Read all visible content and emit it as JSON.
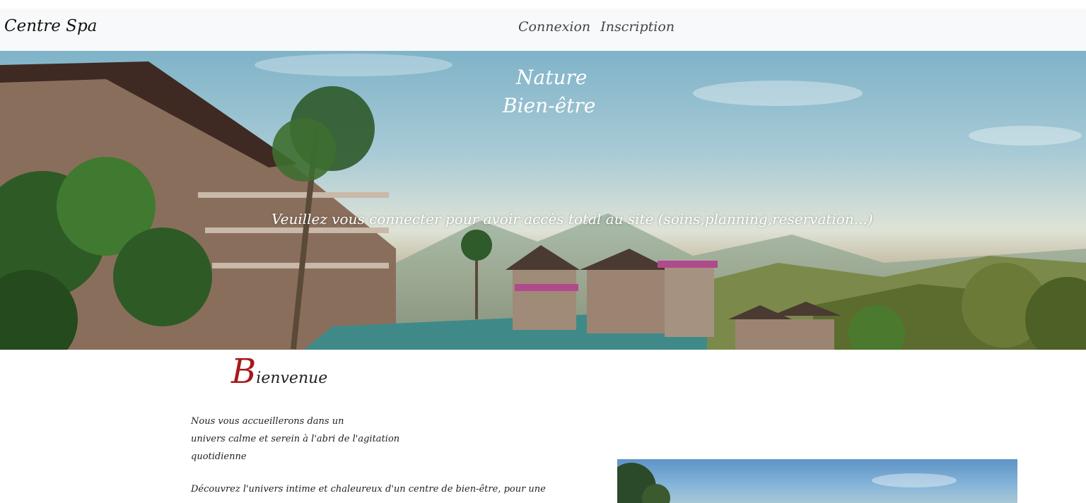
{
  "navbar": {
    "brand": "Centre Spa",
    "links": [
      "Connexion",
      "Inscription"
    ]
  },
  "hero": {
    "title_line1": "Nature",
    "title_line2": "Bien-être",
    "notice": "Veuillez vous connecter pour avoir accès total au site (soins,planning,reservation...)"
  },
  "welcome": {
    "initial": "B",
    "rest": "ienvenue"
  },
  "intro": {
    "lines": [
      "Nous vous accueillerons dans un",
      "univers calme et serein à l'abri de l'agitation",
      "quotidienne"
    ]
  },
  "discover": {
    "text": "Découvrez l'univers intime et chaleureux d'un centre de bien-être, pour une"
  },
  "colors": {
    "navbar_bg": "#f8f9fa",
    "accent_red": "#a7191b",
    "text_dark": "#222222"
  }
}
